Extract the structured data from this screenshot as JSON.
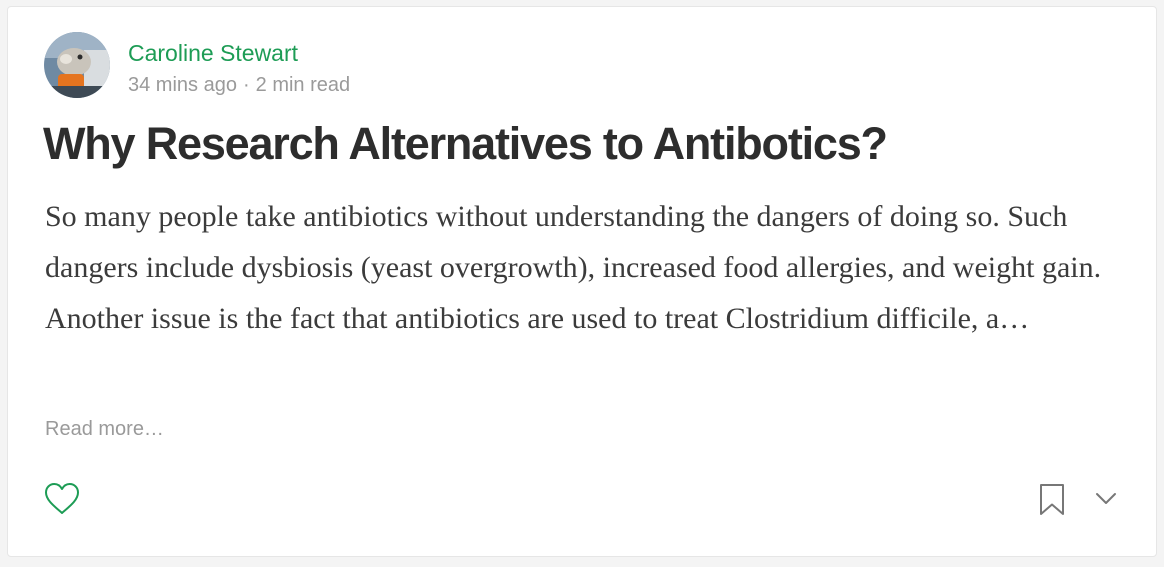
{
  "post": {
    "author": "Caroline Stewart",
    "time_ago": "34 mins ago",
    "separator": "·",
    "read_time": "2 min read",
    "title": "Why Research Alternatives to Antibotics?",
    "excerpt": "So many people take antibiotics without understanding the dangers of doing so. Such dangers include dysbiosis (yeast overgrowth), increased food allergies, and weight gain. Another issue is the fact that antibiotics are used to treat Clostridium difficile, a…",
    "read_more": "Read more…"
  },
  "actions": {
    "like_icon": "heart-icon",
    "bookmark_icon": "bookmark-icon",
    "more_icon": "chevron-down-icon"
  },
  "colors": {
    "author": "#1d9c55",
    "like": "#1d9c55",
    "muted": "#9a9a9a",
    "title": "#2d2d2d",
    "body": "#3b3b3b"
  }
}
